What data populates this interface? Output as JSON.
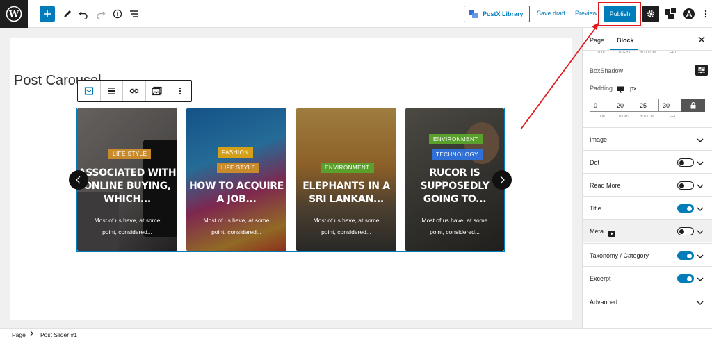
{
  "toolbar": {
    "postx_label": "PostX Library",
    "save_draft": "Save draft",
    "preview": "Preview",
    "publish": "Publish",
    "accent": "#007cba",
    "highlight": "#e0191f"
  },
  "editor": {
    "page_title": "Post Carousel",
    "cards": [
      {
        "badges": [
          "LIFE STYLE"
        ],
        "badge_colors": [
          "#c98a2c"
        ],
        "title_lines": [
          "ASSOCIATED WITH",
          "ONLINE BUYING,",
          "WHICH..."
        ],
        "excerpt_lines": [
          "Most of us have, at some",
          "point, considered..."
        ]
      },
      {
        "badges": [
          "FASHION",
          "LIFE STYLE"
        ],
        "badge_colors": [
          "#d4a017",
          "#c98a2c"
        ],
        "title_lines": [
          "HOW TO ACQUIRE",
          "A JOB..."
        ],
        "excerpt_lines": [
          "Most of us have, at some",
          "point, considered..."
        ]
      },
      {
        "badges": [
          "ENVIRONMENT"
        ],
        "badge_colors": [
          "#5aa02c"
        ],
        "title_lines": [
          "ELEPHANTS IN A",
          "SRI LANKAN..."
        ],
        "excerpt_lines": [
          "Most of us have, at some",
          "point, considered..."
        ]
      },
      {
        "badges": [
          "ENVIRONMENT",
          "TECHNOLOGY"
        ],
        "badge_colors": [
          "#5aa02c",
          "#2f6fd6"
        ],
        "title_lines": [
          "RUCOR IS",
          "SUPPOSEDLY",
          "GOING TO..."
        ],
        "excerpt_lines": [
          "Most of us have, at some",
          "point, considered..."
        ]
      }
    ]
  },
  "sidebar": {
    "tabs": [
      "Page",
      "Block"
    ],
    "dim_labels_top": [
      "TOP",
      "RIGHT",
      "BOTTOM",
      "LEFT"
    ],
    "boxshadow_label": "BoxShadow",
    "padding_label": "Padding",
    "padding_unit": "px",
    "padding_values": [
      "0",
      "20",
      "25",
      "30"
    ],
    "padding_sub": [
      "TOP",
      "RIGHT",
      "BOTTOM",
      "LEFT"
    ],
    "rows": [
      {
        "label": "Image",
        "toggle": null
      },
      {
        "label": "Dot",
        "toggle": "off"
      },
      {
        "label": "Read More",
        "toggle": "off"
      },
      {
        "label": "Title",
        "toggle": "on"
      },
      {
        "label": "Meta",
        "toggle": "off"
      },
      {
        "label": "Taxonomy / Category",
        "toggle": "on"
      },
      {
        "label": "Excerpt",
        "toggle": "on"
      },
      {
        "label": "Advanced",
        "toggle": null
      }
    ]
  },
  "breadcrumb": {
    "root": "Page",
    "current": "Post Slider #1"
  }
}
